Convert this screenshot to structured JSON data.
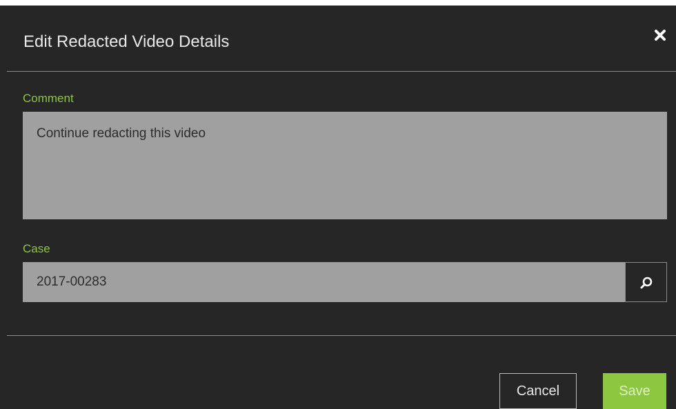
{
  "dialog": {
    "title": "Edit Redacted Video Details",
    "close_icon": "close-icon"
  },
  "form": {
    "comment_label": "Comment",
    "comment_value": "Continue redacting this video",
    "case_label": "Case",
    "case_value": "2017-00283",
    "search_icon": "search-icon"
  },
  "footer": {
    "cancel_label": "Cancel",
    "save_label": "Save"
  },
  "colors": {
    "background": "#262626",
    "accent": "#8dc63f",
    "field_background": "#a0a0a0"
  }
}
